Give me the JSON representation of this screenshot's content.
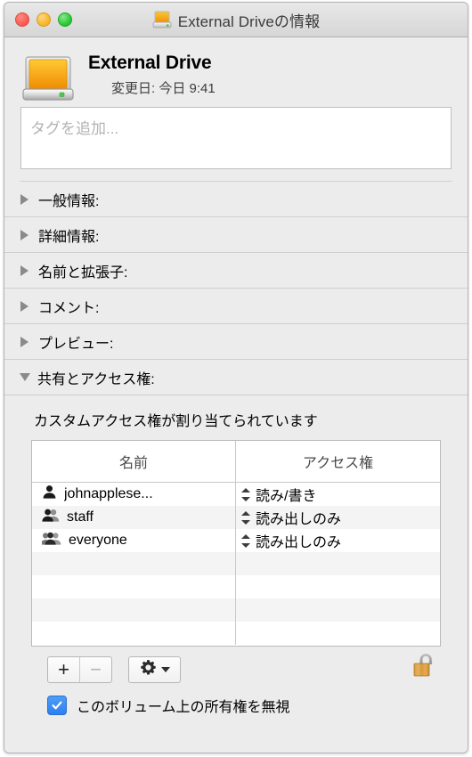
{
  "window": {
    "title": "External Driveの情報",
    "title_icon": "external-drive-icon",
    "traffic_lights": {
      "close": "close-button",
      "minimize": "minimize-button",
      "zoom": "zoom-button",
      "close_color": "#f6584f",
      "minimize_color": "#f5b325",
      "zoom_color": "#23c32e"
    }
  },
  "header": {
    "icon": "external-drive-icon",
    "name": "External Drive",
    "modified": "変更日: 今日 9:41"
  },
  "tags": {
    "placeholder": "タグを追加...",
    "value": ""
  },
  "sections": [
    {
      "label": "一般情報:",
      "expanded": false
    },
    {
      "label": "詳細情報:",
      "expanded": false
    },
    {
      "label": "名前と拡張子:",
      "expanded": false
    },
    {
      "label": "コメント:",
      "expanded": false
    },
    {
      "label": "プレビュー:",
      "expanded": false
    },
    {
      "label": "共有とアクセス権:",
      "expanded": true
    }
  ],
  "permissions": {
    "note": "カスタムアクセス権が割り当てられています",
    "columns": [
      "名前",
      "アクセス権"
    ],
    "rows": [
      {
        "icon": "single-user-icon",
        "name": "johnapplese...",
        "permission": "読み/書き"
      },
      {
        "icon": "group-users-icon",
        "name": "staff",
        "permission": "読み出しのみ"
      },
      {
        "icon": "everyone-users-icon",
        "name": "everyone",
        "permission": "読み出しのみ"
      }
    ],
    "empty_rows": 3
  },
  "toolbar": {
    "add_label": "+",
    "remove_label": "−",
    "remove_disabled": true,
    "action_menu": "gear-icon",
    "lock": {
      "state": "unlocked",
      "color": "#d79a38"
    }
  },
  "ignore_ownership": {
    "checked": true,
    "label": "このボリューム上の所有権を無視",
    "accent": "#2d7ff0"
  }
}
